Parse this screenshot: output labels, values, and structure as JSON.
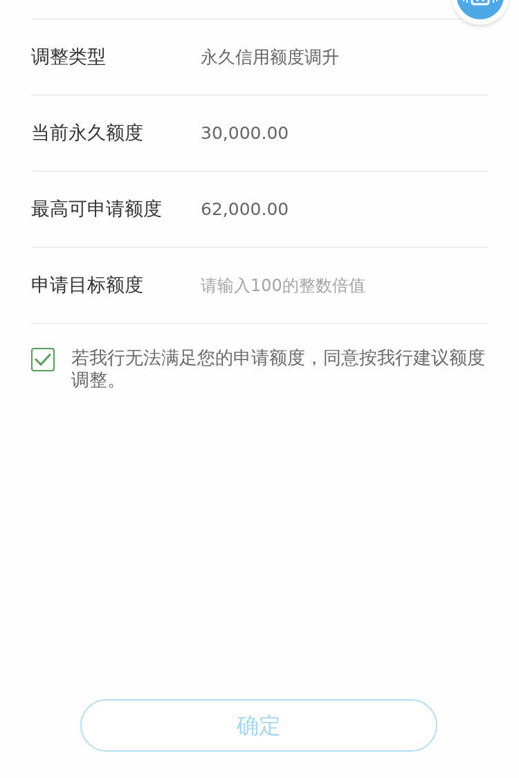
{
  "rows": [
    {
      "kind": "value",
      "label": "调整类型",
      "value": "永久信用额度调升"
    },
    {
      "kind": "value",
      "label": "当前永久额度",
      "value": "30,000.00"
    },
    {
      "kind": "value",
      "label": "最高可申请额度",
      "value": "62,000.00"
    },
    {
      "kind": "input",
      "label": "申请目标额度",
      "placeholder": "请输入100的整数倍值"
    }
  ],
  "agreement": {
    "checked": true,
    "text": "若我行无法满足您的申请额度，同意按我行建议额度调整。"
  },
  "confirm_button": {
    "label": "确定",
    "disabled": true
  }
}
